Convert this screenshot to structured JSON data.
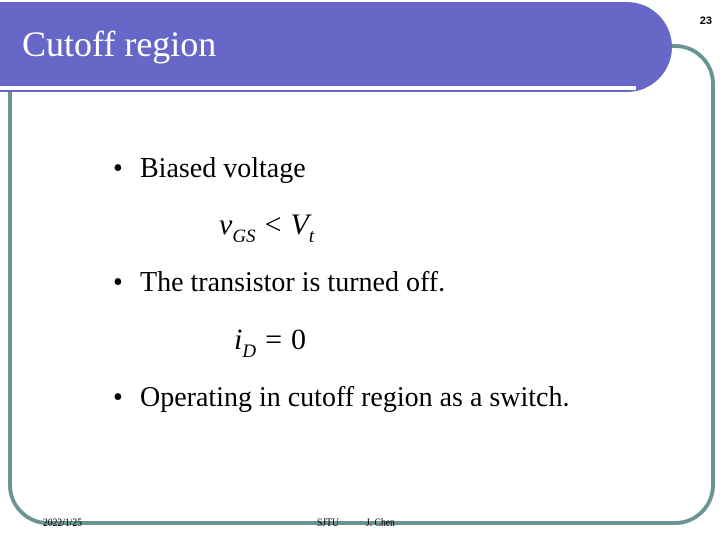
{
  "slide": {
    "title": "Cutoff region",
    "page_number": "23",
    "bullets": [
      {
        "marker": "•",
        "text": "Biased voltage"
      },
      {
        "marker": "•",
        "text": "The transistor is turned off."
      },
      {
        "marker": "•",
        "text": "Operating in cutoff region as a switch."
      }
    ],
    "equations": [
      {
        "lhs_var": "v",
        "lhs_sub": "GS",
        "operator": "<",
        "rhs_var": "V",
        "rhs_sub": "t"
      },
      {
        "lhs_var": "i",
        "lhs_sub": "D",
        "operator": "=",
        "rhs_value": "0"
      }
    ]
  },
  "footer": {
    "date": "2022/1/25",
    "institution": "SJTU",
    "author": "J. Chen"
  },
  "colors": {
    "title_bar": "#6767c7",
    "frame": "#6a9492",
    "title_text": "#ffffff"
  }
}
